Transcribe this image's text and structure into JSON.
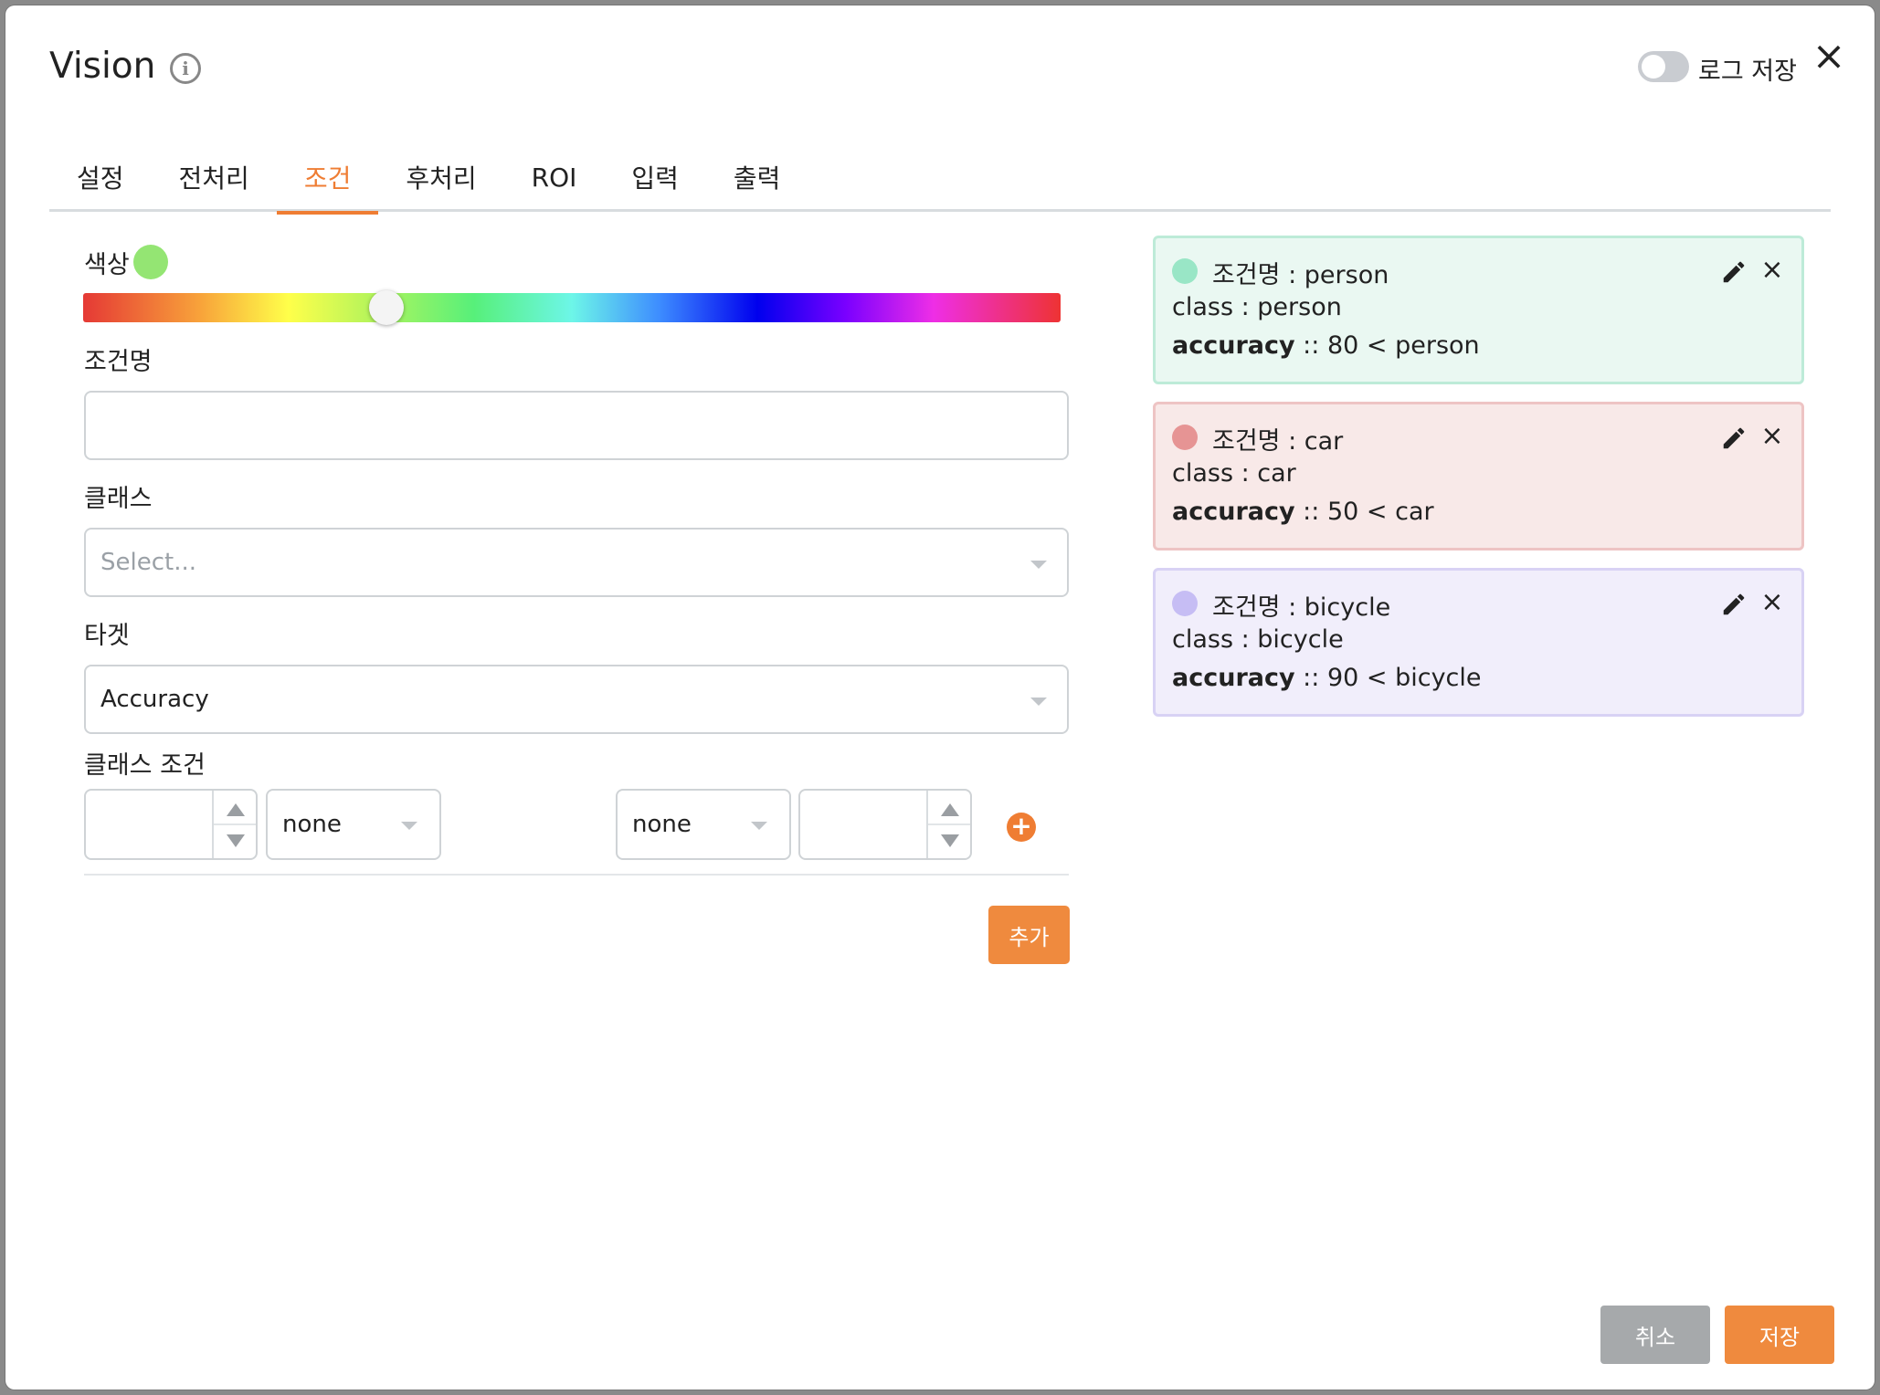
{
  "header": {
    "title": "Vision",
    "info_icon": "info-icon",
    "log_toggle_label": "로그 저장",
    "log_toggle_on": false,
    "close_icon": "close-icon"
  },
  "tabs": [
    {
      "label": "설정",
      "active": false
    },
    {
      "label": "전처리",
      "active": false
    },
    {
      "label": "조건",
      "active": true
    },
    {
      "label": "후처리",
      "active": false
    },
    {
      "label": "ROI",
      "active": false
    },
    {
      "label": "입력",
      "active": false
    },
    {
      "label": "출력",
      "active": false
    }
  ],
  "form": {
    "color_label": "색상",
    "color_value": "#94e573",
    "hue_position": 0.31,
    "condition_name_label": "조건명",
    "condition_name_value": "",
    "class_label": "클래스",
    "class_placeholder": "Select...",
    "target_label": "타겟",
    "target_value": "Accuracy",
    "class_condition_label": "클래스 조건",
    "left_number_value": "",
    "left_operator_value": "none",
    "right_operator_value": "none",
    "right_number_value": "",
    "add_button_label": "추가"
  },
  "conditions": [
    {
      "title": "조건명 : person",
      "class_line": "class : person",
      "acc_key": "accuracy",
      "acc_rest": " :: 80 < person",
      "dot_color": "#99e6c6",
      "bg_color": "#eaf8f2",
      "border_color": "#bdebd8"
    },
    {
      "title": "조건명 : car",
      "class_line": "class : car",
      "acc_key": "accuracy",
      "acc_rest": " :: 50 < car",
      "dot_color": "#e69494",
      "bg_color": "#f8e9e8",
      "border_color": "#eec4c4"
    },
    {
      "title": "조건명 : bicycle",
      "class_line": "class : bicycle",
      "acc_key": "accuracy",
      "acc_rest": " :: 90 < bicycle",
      "dot_color": "#c6bdf4",
      "bg_color": "#f1eefb",
      "border_color": "#d8d2f4"
    }
  ],
  "footer": {
    "cancel_label": "취소",
    "save_label": "저장"
  }
}
